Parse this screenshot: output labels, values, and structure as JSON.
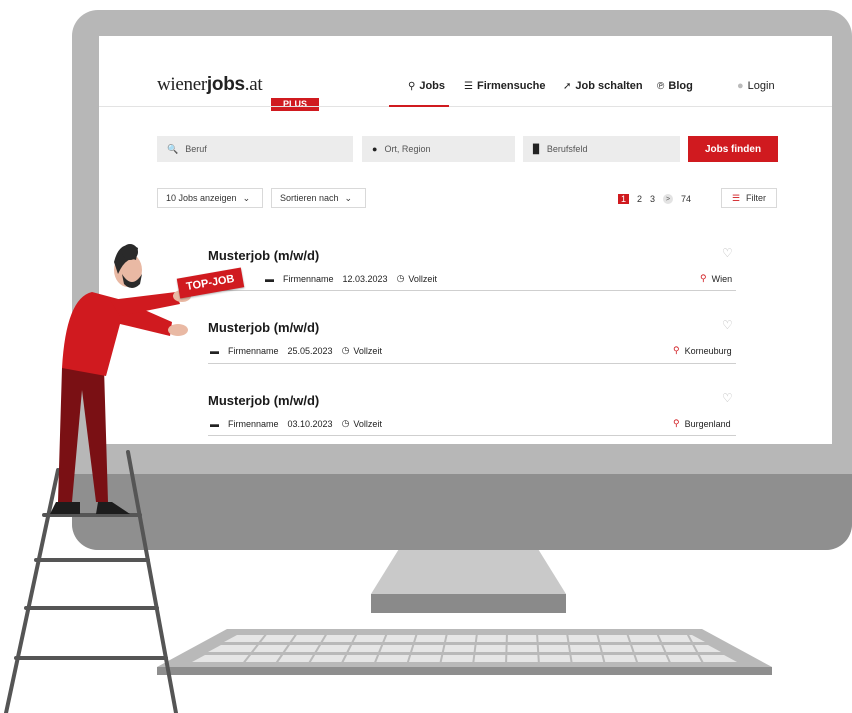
{
  "header": {
    "logo_left": "wiener",
    "logo_jobs": "jobs",
    "logo_right": ".at",
    "logo_plus": "PLUS",
    "nav": [
      {
        "icon": "search-icon",
        "label": "Jobs"
      },
      {
        "icon": "list-icon",
        "label": "Firmensuche"
      },
      {
        "icon": "send-icon",
        "label": "Job schalten"
      },
      {
        "icon": "rss-icon",
        "label": "Blog"
      },
      {
        "icon": "user-icon",
        "label": "Login"
      }
    ]
  },
  "search": {
    "beruf_placeholder": "Beruf",
    "ort_placeholder": "Ort, Region",
    "berufsfeld_placeholder": "Berufsfeld",
    "submit_label": "Jobs finden"
  },
  "controls": {
    "per_page": "10 Jobs anzeigen",
    "sort": "Sortieren nach",
    "pages": [
      "1",
      "2",
      "3"
    ],
    "next": ">",
    "last_page": "74",
    "filter": "Filter"
  },
  "jobs": [
    {
      "title": "Musterjob (m/w/d)",
      "company": "Firmenname",
      "date": "12.03.2023",
      "type": "Vollzeit",
      "location": "Wien"
    },
    {
      "title": "Musterjob (m/w/d)",
      "company": "Firmenname",
      "date": "25.05.2023",
      "type": "Vollzeit",
      "location": "Korneuburg"
    },
    {
      "title": "Musterjob (m/w/d)",
      "company": "Firmenname",
      "date": "03.10.2023",
      "type": "Vollzeit",
      "location": "Burgenland"
    }
  ],
  "badge": "TOP-JOB",
  "colors": {
    "accent": "#d01a1f",
    "monitor": "#b7b7b7"
  }
}
